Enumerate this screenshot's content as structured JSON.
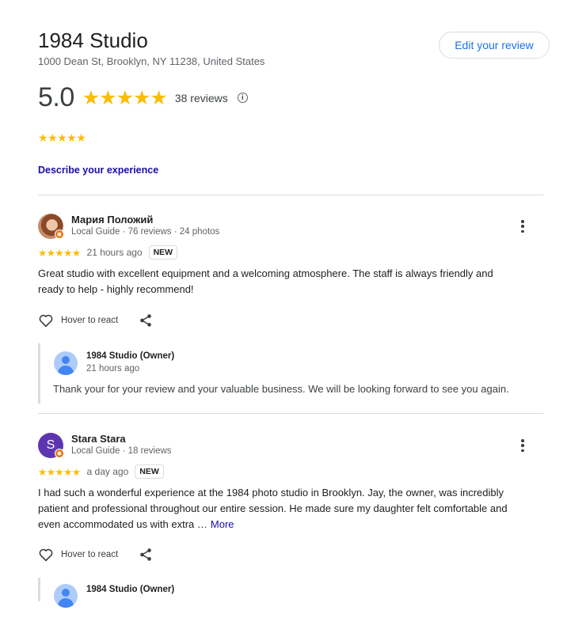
{
  "business": {
    "name": "1984 Studio",
    "address": "1000 Dean St, Brooklyn, NY 11238, United States",
    "edit_review_label": "Edit your review",
    "rating": "5.0",
    "rating_stars": "★★★★★",
    "review_count": "38 reviews",
    "info_glyph": "i"
  },
  "my_review": {
    "stars": "★★★★★",
    "describe_label": "Describe your experience"
  },
  "reviews": [
    {
      "author": "Мария Положий",
      "meta": "Local Guide · 76 reviews · 24 photos",
      "avatar_type": "photo",
      "stars": "★★★★★",
      "time": "21 hours ago",
      "badge": "NEW",
      "text": "Great studio with excellent equipment and a welcoming atmosphere. The staff is always friendly and ready to help - highly recommend!",
      "react_label": "Hover to react",
      "reply": {
        "owner": "1984 Studio (Owner)",
        "time": "21 hours ago",
        "text": "Thank your for your review and your valuable business. We will be looking forward to see you again."
      }
    },
    {
      "author": "Stara Stara",
      "meta": "Local Guide · 18 reviews",
      "avatar_letter": "S",
      "avatar_color": "#5e35b1",
      "stars": "★★★★★",
      "time": "a day ago",
      "badge": "NEW",
      "text": "I had such a wonderful experience at the 1984 photo studio in Brooklyn. Jay, the owner, was incredibly patient and professional throughout our entire session. He made sure my daughter felt comfortable and even accommodated us with extra …",
      "more_label": "More",
      "react_label": "Hover to react",
      "reply": {
        "owner": "1984 Studio (Owner)"
      }
    }
  ],
  "colors": {
    "star": "#fbbc04",
    "link": "#1a0dab",
    "accent": "#1a73e8",
    "local_guide_badge": "#e8710a"
  }
}
